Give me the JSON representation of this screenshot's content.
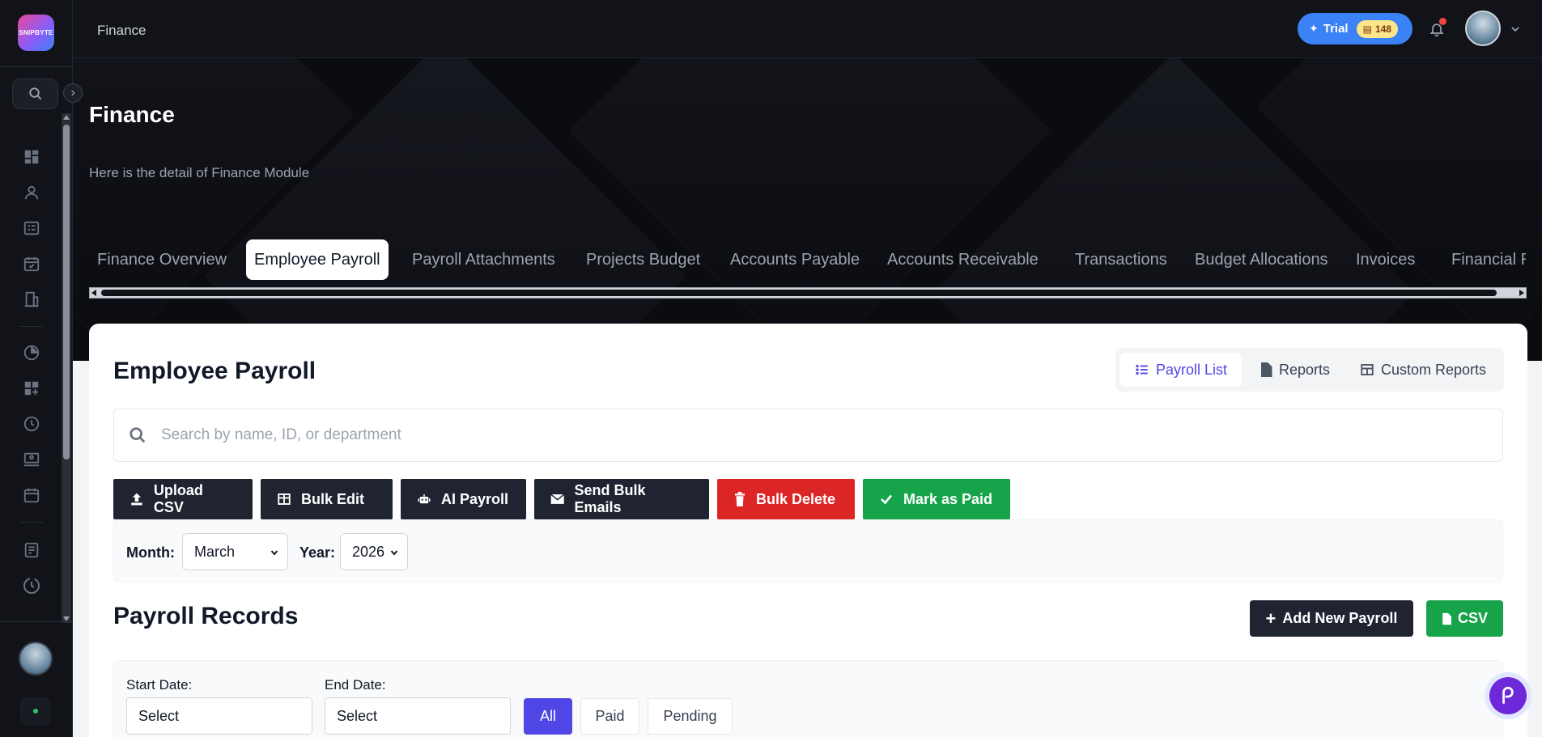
{
  "sidebar": {
    "logo_text": "SNIPBYTE",
    "icons": [
      "search-icon",
      "dashboard-icon",
      "user-icon",
      "list-card-icon",
      "calendar-check-icon",
      "building-icon",
      "pie-icon",
      "grid-plus-icon",
      "clock-icon",
      "screen-user-icon",
      "calendar-icon",
      "document-icon",
      "history-icon"
    ]
  },
  "header": {
    "breadcrumb": "Finance",
    "trial_label": "Trial",
    "trial_coins": "148"
  },
  "hero": {
    "title": "Finance",
    "subtitle": "Here is the detail of Finance Module"
  },
  "tabs": [
    {
      "label": "Finance Overview"
    },
    {
      "label": "Employee Payroll",
      "active": true
    },
    {
      "label": "Payroll Attachments"
    },
    {
      "label": "Projects Budget"
    },
    {
      "label": "Accounts Payable"
    },
    {
      "label": "Accounts Receivable"
    },
    {
      "label": "Transactions"
    },
    {
      "label": "Budget Allocations"
    },
    {
      "label": "Invoices"
    },
    {
      "label": "Financial Re"
    }
  ],
  "payroll": {
    "title": "Employee Payroll",
    "views": [
      {
        "label": "Payroll List",
        "active": true
      },
      {
        "label": "Reports"
      },
      {
        "label": "Custom Reports"
      }
    ],
    "search_placeholder": "Search by name, ID, or department",
    "actions": [
      {
        "label": "Upload CSV",
        "color": "#1f2430"
      },
      {
        "label": "Bulk Edit",
        "color": "#1f2430"
      },
      {
        "label": "AI Payroll",
        "color": "#1f2430"
      },
      {
        "label": "Send Bulk Emails",
        "color": "#1f2430"
      },
      {
        "label": "Bulk Delete",
        "color": "#dc2626"
      },
      {
        "label": "Mark as Paid",
        "color": "#16a34a"
      }
    ],
    "month_label": "Month:",
    "month_value": "March",
    "year_label": "Year:",
    "year_value": "2026"
  },
  "records": {
    "title": "Payroll Records",
    "add_label": "Add New Payroll",
    "csv_label": "CSV",
    "start_label": "Start Date:",
    "start_value": "Select",
    "end_label": "End Date:",
    "end_value": "Select",
    "status_filters": [
      {
        "label": "All",
        "active": true
      },
      {
        "label": "Paid"
      },
      {
        "label": "Pending"
      }
    ]
  },
  "colors": {
    "accent": "#4f46e5",
    "trial": "#3b82f6",
    "danger": "#dc2626",
    "success": "#16a34a"
  }
}
